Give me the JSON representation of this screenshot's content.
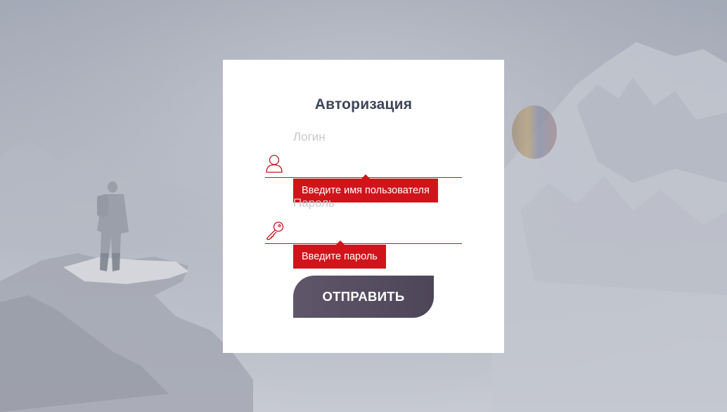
{
  "form": {
    "title": "Авторизация",
    "login": {
      "label": "Логин",
      "value": "",
      "error": "Введите имя пользователя",
      "icon": "user-icon"
    },
    "password": {
      "label": "Пароль",
      "value": "",
      "error": "Введите пароль",
      "icon": "key-icon"
    },
    "submit_label": "ОТПРАВИТЬ"
  },
  "colors": {
    "accent": "#d1141b",
    "title": "#3d4557",
    "button": "#554d60",
    "card": "#ffffff",
    "background": "#a9aebb"
  }
}
